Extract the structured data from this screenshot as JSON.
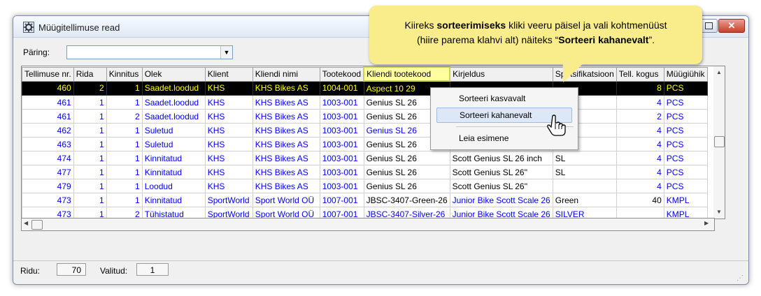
{
  "window": {
    "title": "Müügitellimuse read"
  },
  "query": {
    "label": "Päring:",
    "value": ""
  },
  "grid": {
    "headers": [
      "Tellimuse nr.",
      "Rida",
      "Kinnitus",
      "Olek",
      "Klient",
      "Kliendi nimi",
      "Tootekood",
      "Kliendi tootekood",
      "Kirjeldus",
      "Spetsifikatsioon",
      "Tell. kogus",
      "Müügiühik"
    ],
    "rows": [
      [
        "460",
        "2",
        "1",
        "Saadet.loodud",
        "KHS",
        "KHS Bikes AS",
        "1004-001",
        "Aspect 10 29",
        "",
        "",
        "8",
        "PCS"
      ],
      [
        "461",
        "1",
        "1",
        "Saadet.loodud",
        "KHS",
        "KHS Bikes AS",
        "1003-001",
        "Genius SL 26",
        "",
        "",
        "4",
        "PCS"
      ],
      [
        "461",
        "1",
        "2",
        "Saadet.loodud",
        "KHS",
        "KHS Bikes AS",
        "1003-001",
        "Genius SL 26",
        "",
        "",
        "2",
        "PCS"
      ],
      [
        "462",
        "1",
        "1",
        "Suletud",
        "KHS",
        "KHS Bikes AS",
        "1003-001",
        "Genius SL 26",
        "",
        "",
        "4",
        "PCS"
      ],
      [
        "463",
        "1",
        "1",
        "Suletud",
        "KHS",
        "KHS Bikes AS",
        "1003-001",
        "Genius SL 26",
        "Scott Genius SL 26 inch",
        "SL",
        "4",
        "PCS"
      ],
      [
        "474",
        "1",
        "1",
        "Kinnitatud",
        "KHS",
        "KHS Bikes AS",
        "1003-001",
        "Genius SL 26",
        "Scott Genius SL 26 inch",
        "SL",
        "4",
        "PCS"
      ],
      [
        "477",
        "1",
        "1",
        "Kinnitatud",
        "KHS",
        "KHS Bikes AS",
        "1003-001",
        "Genius SL 26",
        "Scott Genius SL 26''",
        "SL",
        "4",
        "PCS"
      ],
      [
        "479",
        "1",
        "1",
        "Loodud",
        "KHS",
        "KHS Bikes AS",
        "1003-001",
        "Genius SL 26",
        "Scott Genius SL 26''",
        "",
        "4",
        "PCS"
      ],
      [
        "473",
        "1",
        "1",
        "Kinnitatud",
        "SportWorld",
        "Sport World OÜ",
        "1007-001",
        "JBSC-3407-Green-26",
        "Junior Bike Scott Scale 26",
        "Green",
        "40",
        "KMPL"
      ],
      [
        "473",
        "1",
        "2",
        "Tühistatud",
        "SportWorld",
        "Sport World OÜ",
        "1007-001",
        "JBSC-3407-Silver-26",
        "Junior Bike Scott Scale 26",
        "SILVER",
        "",
        "KMPL"
      ]
    ]
  },
  "context_menu": {
    "items": [
      "Sorteeri kasvavalt",
      "Sorteeri kahanevalt",
      "Leia esimene"
    ]
  },
  "callout": {
    "line1_a": "Kiireks ",
    "line1_b": "sorteerimiseks",
    "line1_c": " kliki veeru päisel ja vali kohtmenüüst",
    "line2_a": "(hiire parema klahvi alt) näiteks “",
    "line2_b": "Sorteeri kahanevalt",
    "line2_c": "”."
  },
  "status": {
    "rows_label": "Ridu:",
    "rows_value": "70",
    "selected_label": "Valitud:",
    "selected_value": "1"
  },
  "colors": {
    "selected_row_bg": "#000000",
    "selected_row_text": "#ffff00",
    "row_text": "#0000ff",
    "callout_bg": "#f9ec8a"
  }
}
